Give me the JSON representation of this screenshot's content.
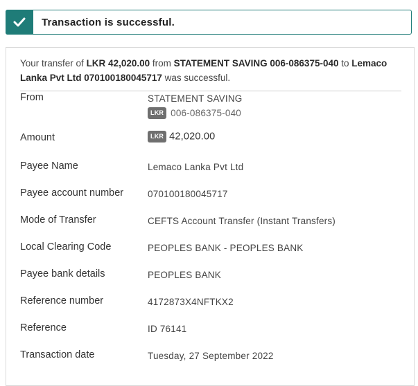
{
  "banner": {
    "icon": "check-icon",
    "text": "Transaction is successful.",
    "color": "#1f7c78"
  },
  "summary": {
    "p1": "Your transfer of ",
    "amount": "LKR 42,020.00",
    "p2": " from ",
    "from": "STATEMENT SAVING 006-086375-040",
    "p3": " to ",
    "to": "Lemaco Lanka Pvt Ltd 070100180045717",
    "p4": " was successful."
  },
  "details": {
    "from": {
      "label": "From",
      "account_name": "STATEMENT SAVING",
      "currency": "LKR",
      "account_number": "006-086375-040"
    },
    "amount": {
      "label": "Amount",
      "currency": "LKR",
      "value": "42,020.00"
    },
    "payee_name": {
      "label": "Payee Name",
      "value": "Lemaco Lanka Pvt Ltd"
    },
    "payee_account": {
      "label": "Payee account number",
      "value": "070100180045717"
    },
    "mode": {
      "label": "Mode of Transfer",
      "value": "CEFTS Account Transfer (Instant Transfers)"
    },
    "clearing_code": {
      "label": "Local Clearing Code",
      "value": "PEOPLES BANK - PEOPLES BANK"
    },
    "bank_details": {
      "label": "Payee bank details",
      "value": "PEOPLES BANK"
    },
    "reference_number": {
      "label": "Reference number",
      "value": "4172873X4NFTKX2"
    },
    "reference": {
      "label": "Reference",
      "value": "ID 76141"
    },
    "date": {
      "label": "Transaction date",
      "value": "Tuesday, 27 September 2022"
    }
  }
}
